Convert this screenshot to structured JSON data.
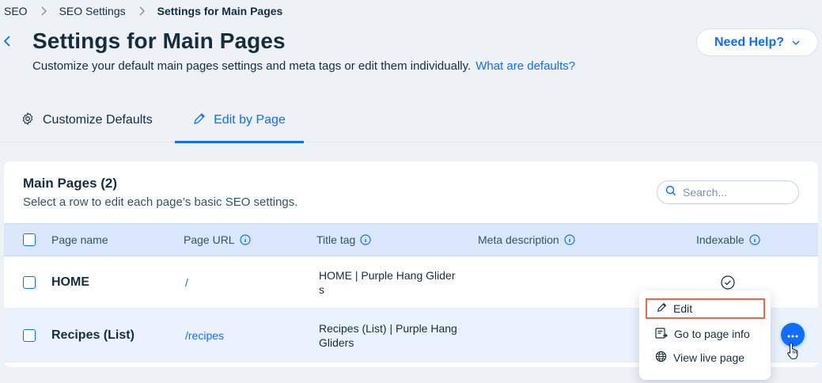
{
  "breadcrumb": [
    "SEO",
    "SEO Settings",
    "Settings for Main Pages"
  ],
  "header": {
    "title": "Settings for Main Pages",
    "subtitle": "Customize your default main pages settings and meta tags or edit them individually.",
    "subtitle_link": "What are defaults?",
    "help_button": "Need Help?"
  },
  "tabs": [
    {
      "label": "Customize Defaults",
      "icon": "gear-icon",
      "active": false
    },
    {
      "label": "Edit by Page",
      "icon": "pencil-icon",
      "active": true
    }
  ],
  "card": {
    "title": "Main Pages (2)",
    "subtitle": "Select a row to edit each page’s basic SEO settings.",
    "search_placeholder": "Search..."
  },
  "table": {
    "columns": [
      "Page name",
      "Page URL",
      "Title tag",
      "Meta description",
      "Indexable"
    ],
    "rows": [
      {
        "name": "HOME",
        "url": "/",
        "title_line1": "HOME | Purple Hang Glider",
        "title_line2": "s",
        "indexable": true
      },
      {
        "name": "Recipes (List)",
        "url": "/recipes",
        "title_line1": "Recipes (List) | Purple Hang",
        "title_line2": "Gliders",
        "indexable": true
      }
    ]
  },
  "menu": {
    "items": [
      {
        "label": "Edit",
        "icon": "pencil-icon"
      },
      {
        "label": "Go to page info",
        "icon": "page-info-icon"
      },
      {
        "label": "View live page",
        "icon": "globe-icon"
      }
    ]
  },
  "colors": {
    "accent": "#116dff",
    "highlight": "#e8684a",
    "header_row": "#dae7fc"
  }
}
